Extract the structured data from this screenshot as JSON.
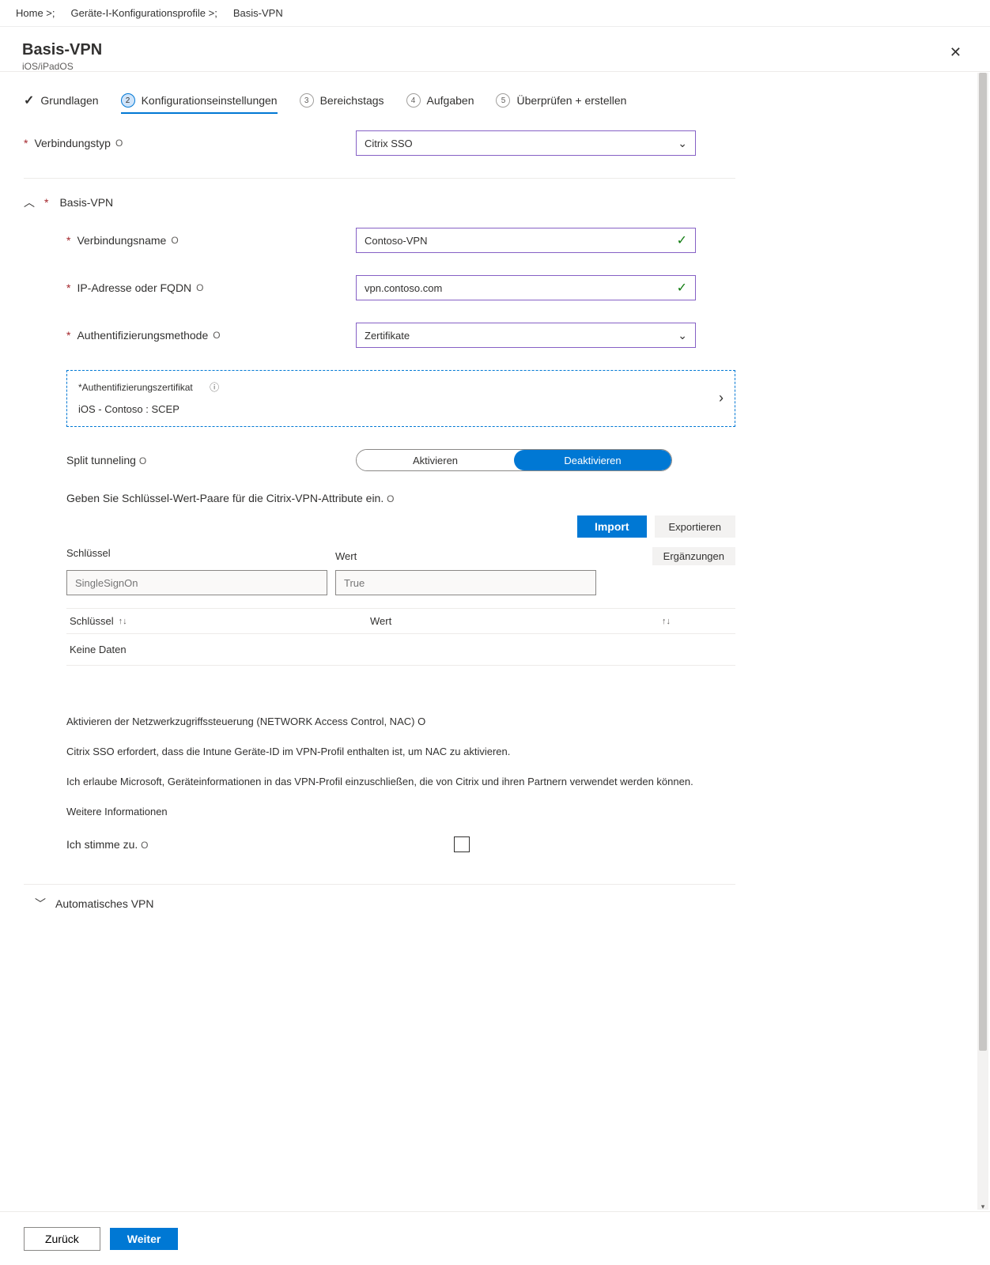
{
  "breadcrumbs": {
    "home": "Home >;",
    "devices": "Geräte-I-Konfigurationsprofile >;",
    "current": "Basis-VPN"
  },
  "header": {
    "title": "Basis-VPN",
    "subtitle": "iOS/iPadOS"
  },
  "steps": {
    "s1": "Grundlagen",
    "s2": "Konfigurationseinstellungen",
    "s3": "Bereichstags",
    "s4": "Aufgaben",
    "s5": "Überprüfen + erstellen",
    "n2": "2",
    "n3": "3",
    "n4": "4",
    "n5": "5"
  },
  "conn_type": {
    "label": "Verbindungstyp",
    "info": "O",
    "value": "Citrix SSO"
  },
  "group": {
    "title": "Basis-VPN"
  },
  "conn_name": {
    "label": "Verbindungsname",
    "info": "O",
    "value": "Contoso-VPN"
  },
  "ip": {
    "label": "IP-Adresse oder FQDN",
    "info": "O",
    "value": "vpn.contoso.com"
  },
  "auth_method": {
    "label": "Authentifizierungsmethode",
    "info": "O",
    "value": "Zertifikate"
  },
  "cert": {
    "label": "*Authentifizierungszertifikat",
    "value": "iOS  -  Contoso :     SCEP"
  },
  "split": {
    "label": "Split tunneling",
    "info": "O",
    "enable": "Aktivieren",
    "disable": "Deaktivieren"
  },
  "kv": {
    "hint": "Geben Sie Schlüssel-Wert-Paare für die Citrix-VPN-Attribute ein.",
    "info": "O",
    "import": "Import",
    "export": "Exportieren",
    "add": "Ergänzungen",
    "key_label": "Schlüssel",
    "val_label": "Wert",
    "key_ph": "SingleSignOn",
    "val_ph": "True",
    "th_key": "Schlüssel",
    "th_val": "Wert",
    "empty": "Keine Daten"
  },
  "nac": {
    "l1": "Aktivieren der Netzwerkzugriffssteuerung (NETWORK Access Control, NAC) O",
    "l2": "Citrix SSO erfordert, dass die Intune Geräte-ID im VPN-Profil enthalten ist, um NAC zu aktivieren.",
    "l3": "Ich erlaube Microsoft, Geräteinformationen in das VPN-Profil einzuschließen, die von Citrix und ihren Partnern verwendet werden können.",
    "link": "Weitere Informationen"
  },
  "agree": {
    "label": "Ich stimme zu.",
    "info": "O"
  },
  "auto_vpn": {
    "label": "Automatisches VPN"
  },
  "footer": {
    "back": "Zurück",
    "next": "Weiter"
  }
}
